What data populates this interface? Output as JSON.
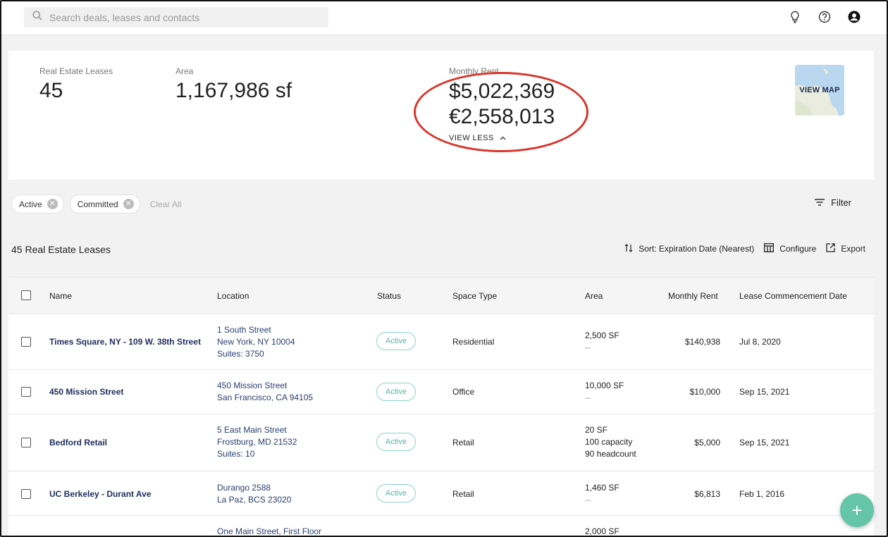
{
  "search": {
    "placeholder": "Search deals, leases and contacts"
  },
  "summary": {
    "leases_label": "Real Estate Leases",
    "leases_value": "45",
    "area_label": "Area",
    "area_value": "1,167,986 sf",
    "rent_label": "Monthly Rent",
    "rent_usd": "$5,022,369",
    "rent_eur": "€2,558,013",
    "view_less": "VIEW LESS",
    "view_map": "VIEW MAP"
  },
  "filters": {
    "chips": [
      "Active",
      "Committed"
    ],
    "clear_all": "Clear All",
    "filter_label": "Filter"
  },
  "toolbar": {
    "count_label": "45 Real Estate Leases",
    "sort_label": "Sort: Expiration Date (Nearest)",
    "configure_label": "Configure",
    "export_label": "Export"
  },
  "table": {
    "columns": [
      "Name",
      "Location",
      "Status",
      "Space Type",
      "Area",
      "Monthly Rent",
      "Lease Commencement Date"
    ],
    "rows": [
      {
        "name": "Times Square, NY - 109 W. 38th Street",
        "location": [
          "1 South Street",
          "New York, NY 10004",
          "Suites: 3750"
        ],
        "status": "Active",
        "space_type": "Residential",
        "area": [
          "2,500 SF",
          "--"
        ],
        "rent": "$140,938",
        "commencement": "Jul 8, 2020"
      },
      {
        "name": "450 Mission Street",
        "location": [
          "450 Mission Street",
          "San Francisco, CA 94105"
        ],
        "status": "Active",
        "space_type": "Office",
        "area": [
          "10,000 SF",
          "--"
        ],
        "rent": "$10,000",
        "commencement": "Sep 15, 2021"
      },
      {
        "name": "Bedford Retail",
        "location": [
          "5 East Main Street",
          "Frostburg, MD 21532",
          "Suites: 10"
        ],
        "status": "Active",
        "space_type": "Retail",
        "area": [
          "20 SF",
          "100 capacity",
          "90 headcount"
        ],
        "rent": "$5,000",
        "commencement": "Sep 15, 2021"
      },
      {
        "name": "UC Berkeley - Durant Ave",
        "location": [
          "Durango 2588",
          "La Paz, BCS 23020"
        ],
        "status": "Active",
        "space_type": "Retail",
        "area": [
          "1,460 SF",
          "--"
        ],
        "rent": "$6,813",
        "commencement": "Feb 1, 2016"
      },
      {
        "name": "",
        "location": [
          "One Main Street, First Floor"
        ],
        "status": "",
        "space_type": "",
        "area": [
          "2,000 SF"
        ],
        "rent": "",
        "commencement": ""
      }
    ]
  },
  "icons": {
    "search": "search-icon",
    "bulb": "lightbulb-icon",
    "help": "help-icon",
    "account": "account-icon",
    "fab": "plus-icon"
  },
  "colors": {
    "annotation": "#d9362b",
    "status_active": "#4fb8a2",
    "link_name": "#1f2d5c",
    "fab": "#64c6a7"
  }
}
